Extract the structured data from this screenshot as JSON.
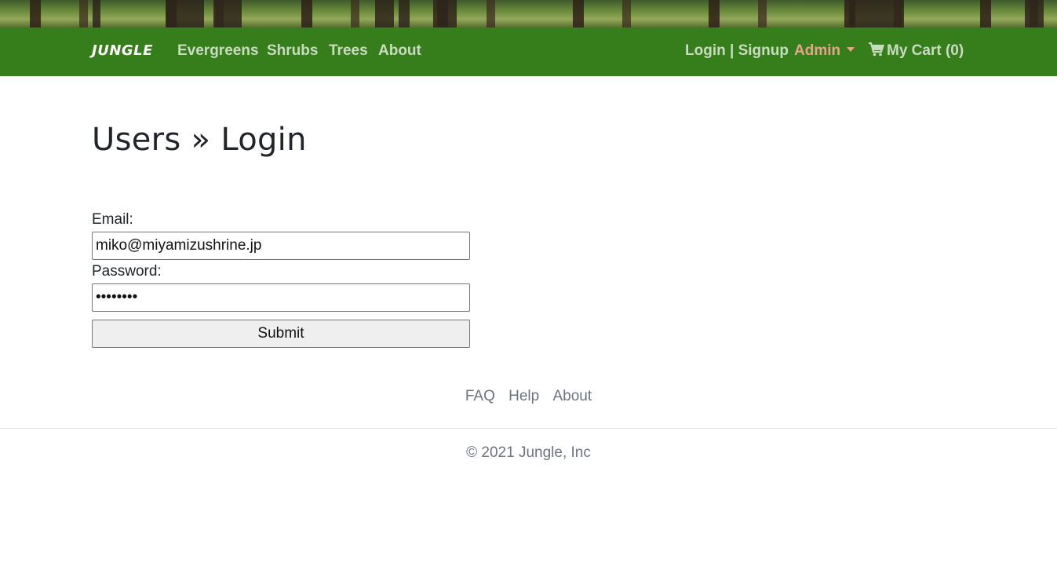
{
  "navbar": {
    "brand": "JUNGLE",
    "links": [
      {
        "label": "Evergreens"
      },
      {
        "label": "Shrubs"
      },
      {
        "label": "Trees"
      },
      {
        "label": "About"
      }
    ],
    "login_signup": "Login | Signup",
    "admin": "Admin",
    "cart": "My Cart (0)",
    "cart_icon": "shopping-cart-icon",
    "background_color": "#367d1b",
    "admin_color": "#e9a38a"
  },
  "page": {
    "title": "Users » Login"
  },
  "form": {
    "email_label": "Email:",
    "email_value": "miko@miyamizushrine.jp",
    "password_label": "Password:",
    "password_value": "••••••••",
    "submit_label": "Submit"
  },
  "footer": {
    "links": [
      {
        "label": "FAQ"
      },
      {
        "label": "Help"
      },
      {
        "label": "About"
      }
    ],
    "copyright": "© 2021 Jungle, Inc"
  }
}
